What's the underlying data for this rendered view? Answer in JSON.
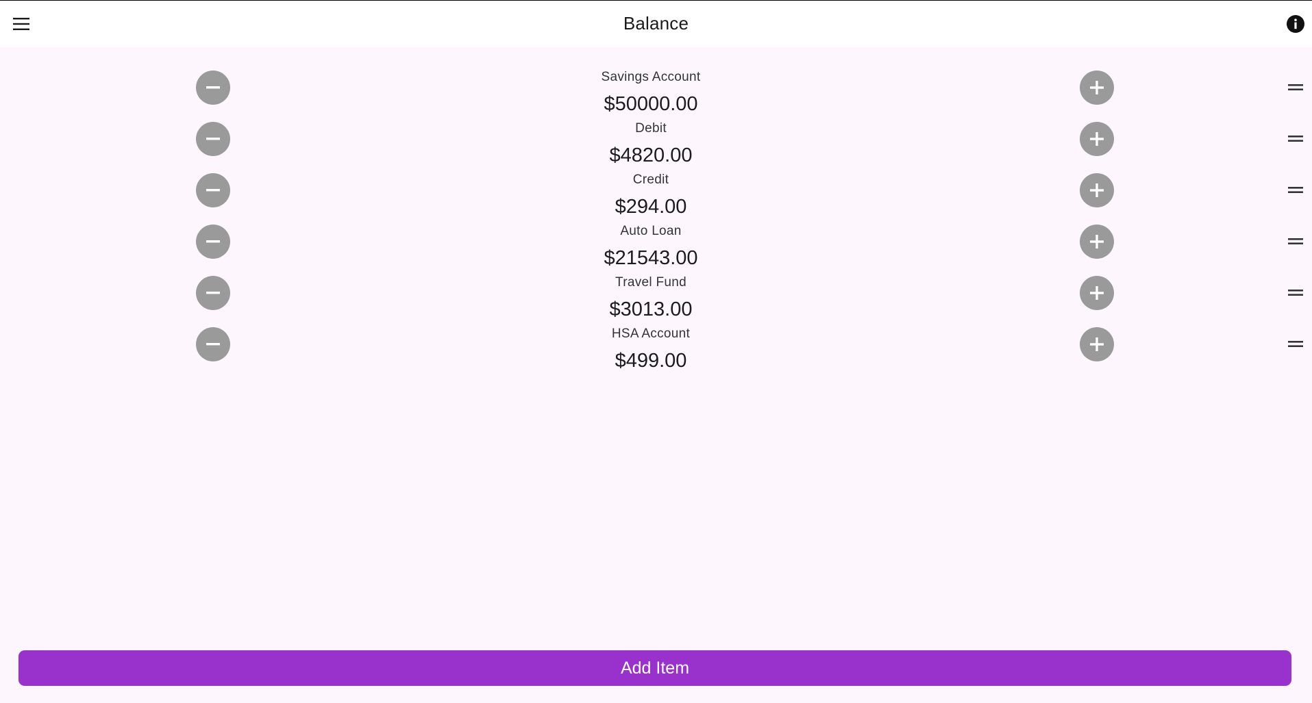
{
  "header": {
    "title": "Balance",
    "menu_icon": "hamburger-menu-icon",
    "info_icon": "info-icon"
  },
  "items": [
    {
      "name": "Savings Account",
      "amount": "$50000.00"
    },
    {
      "name": "Debit",
      "amount": "$4820.00"
    },
    {
      "name": "Credit",
      "amount": "$294.00"
    },
    {
      "name": "Auto Loan",
      "amount": "$21543.00"
    },
    {
      "name": "Travel Fund",
      "amount": "$3013.00"
    },
    {
      "name": "HSA Account",
      "amount": "$499.00"
    }
  ],
  "footer": {
    "add_label": "Add Item"
  },
  "colors": {
    "background": "#fdf7fd",
    "appbar": "#ffffff",
    "accent": "#9932cc",
    "round_button": "#9a9a9a"
  }
}
